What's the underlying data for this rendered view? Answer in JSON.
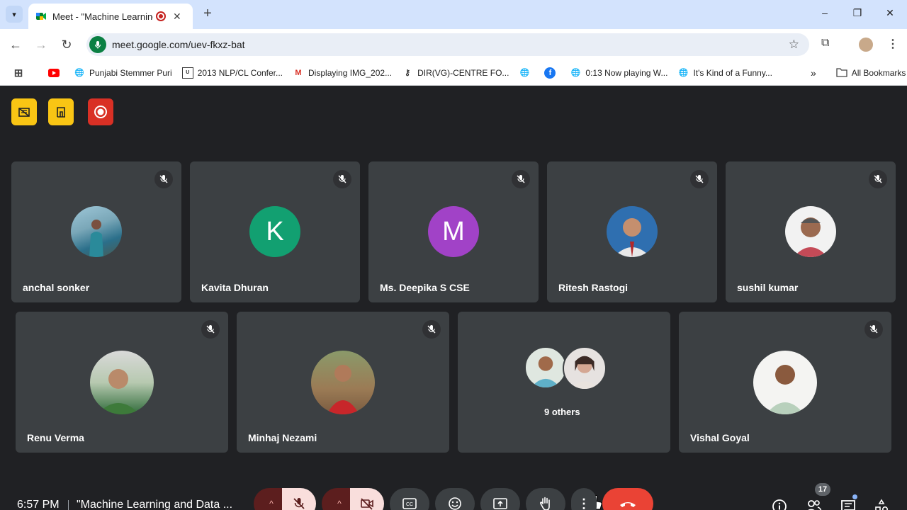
{
  "browser": {
    "tab_title": "Meet - \"Machine Learning a",
    "url": "meet.google.com/uev-fkxz-bat",
    "bookmarks": [
      {
        "label": "",
        "icon": "youtube-icon"
      },
      {
        "label": "Punjabi Stemmer Puri",
        "icon": "globe-icon"
      },
      {
        "label": "2013 NLP/CL Confer...",
        "icon": "site-icon"
      },
      {
        "label": "Displaying IMG_202...",
        "icon": "gmail-icon"
      },
      {
        "label": "DIR(VG)-CENTRE FO...",
        "icon": "key-icon"
      },
      {
        "label": "",
        "icon": "globe-icon"
      },
      {
        "label": "",
        "icon": "facebook-icon"
      },
      {
        "label": "0:13 Now playing W...",
        "icon": "globe-icon"
      },
      {
        "label": "It's Kind of a Funny...",
        "icon": "globe-icon"
      }
    ],
    "all_bookmarks": "All Bookmarks"
  },
  "participants_row1": [
    {
      "name": "anchal sonker",
      "avatar": "photo",
      "color": "#6b8f9e"
    },
    {
      "name": "Kavita Dhuran",
      "avatar": "letter",
      "letter": "K",
      "color": "#12a071"
    },
    {
      "name": "Ms. Deepika S CSE",
      "avatar": "letter",
      "letter": "M",
      "color": "#a142c7"
    },
    {
      "name": "Ritesh Rastogi",
      "avatar": "photo",
      "color": "#2f6fb0"
    },
    {
      "name": "sushil kumar",
      "avatar": "photo",
      "color": "#e8e8e8"
    }
  ],
  "participants_row2": [
    {
      "name": "Renu Verma",
      "avatar": "photo",
      "color": "#3d6e3d"
    },
    {
      "name": "Minhaj Nezami",
      "avatar": "photo",
      "color": "#9b6b45"
    },
    {
      "name": "Vishal Goyal",
      "avatar": "photo",
      "color": "#e6e9e4"
    }
  ],
  "others": {
    "label": "9 others"
  },
  "bottom": {
    "time": "6:57 PM",
    "meeting_title": "\"Machine Learning and Data ...",
    "participant_count": "17"
  },
  "colors": {
    "background": "#202124",
    "tile": "#3c4043",
    "hangup": "#ea4335",
    "badge_yellow": "#f9c514",
    "badge_red": "#d93025"
  }
}
